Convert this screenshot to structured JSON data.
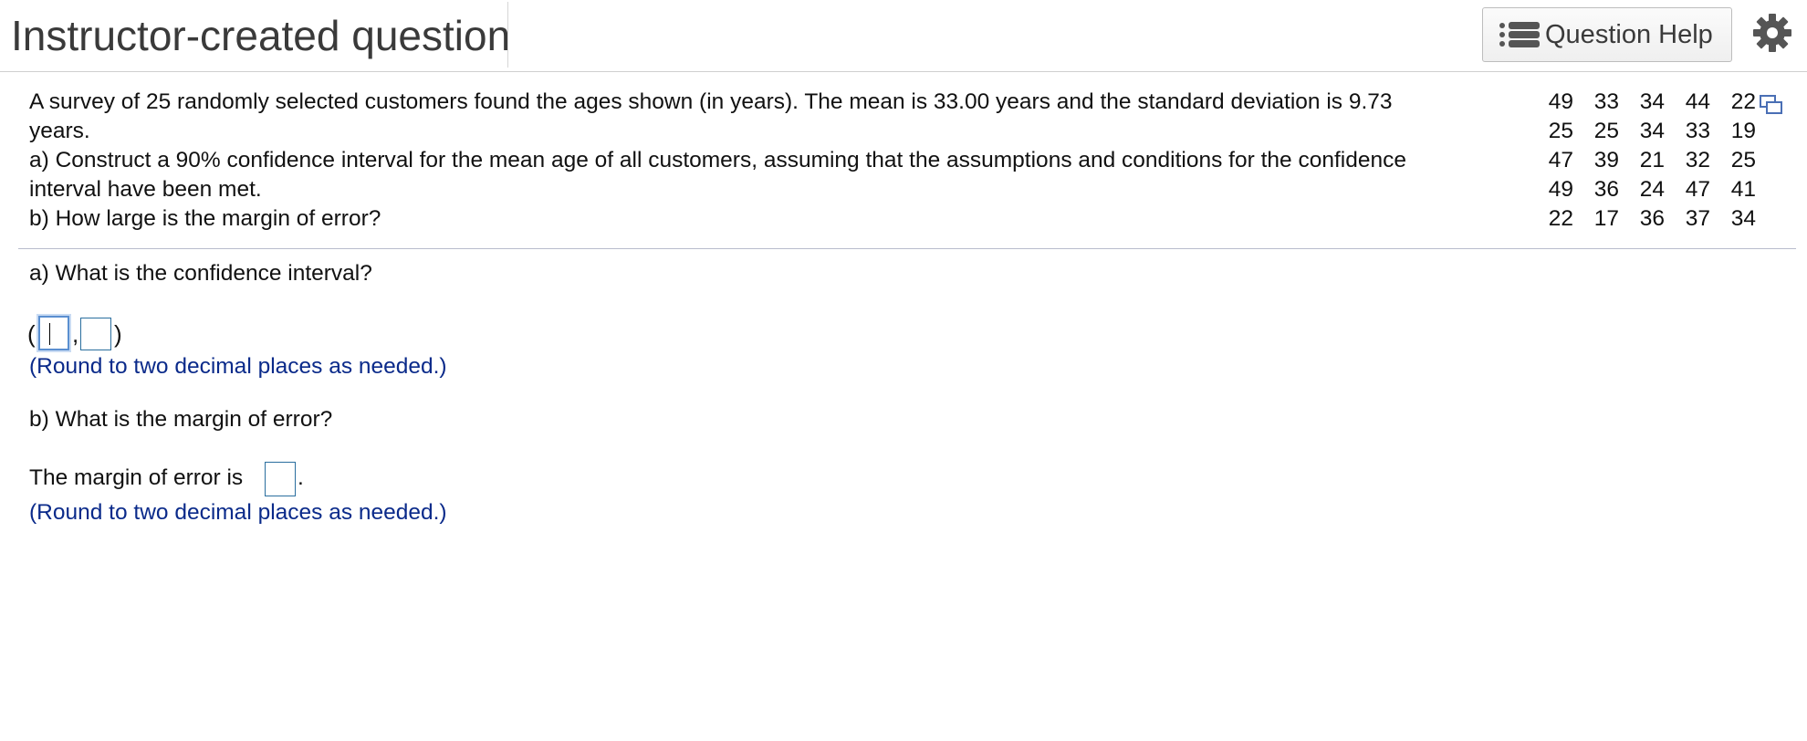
{
  "header": {
    "title": "Instructor-created question",
    "help_label": "Question Help"
  },
  "icons": {
    "help": "list-icon",
    "settings": "gear-icon",
    "copy": "copy-data-icon"
  },
  "colors": {
    "hint_text": "#0a2a8a",
    "input_border": "#2a6e9e",
    "title_text": "#3a3a3a"
  },
  "problem": {
    "lines": [
      "A survey of 25 randomly selected customers found the ages shown (in years). The mean is 33.00 years and the standard deviation is 9.73",
      "years.",
      "a) Construct a 90% confidence interval for the mean age of all customers, assuming that the assumptions and conditions for the confidence",
      "interval have been met.",
      "b) How large is the margin of error?"
    ]
  },
  "data_table": {
    "rows": [
      [
        "49",
        "33",
        "34",
        "44",
        "22"
      ],
      [
        "25",
        "25",
        "34",
        "33",
        "19"
      ],
      [
        "47",
        "39",
        "21",
        "32",
        "25"
      ],
      [
        "49",
        "36",
        "24",
        "47",
        "41"
      ],
      [
        "22",
        "17",
        "36",
        "37",
        "34"
      ]
    ]
  },
  "part_a": {
    "question": "a) What is the confidence interval?",
    "open_paren": "(",
    "comma": ",",
    "close_paren": ")",
    "lower_value": "",
    "upper_value": "",
    "hint": "(Round to two decimal places as needed.)"
  },
  "part_b": {
    "question": "b) What is the margin of error?",
    "lead": "The margin of error is",
    "period": ".",
    "value": "",
    "hint": "(Round to two decimal places as needed.)"
  }
}
